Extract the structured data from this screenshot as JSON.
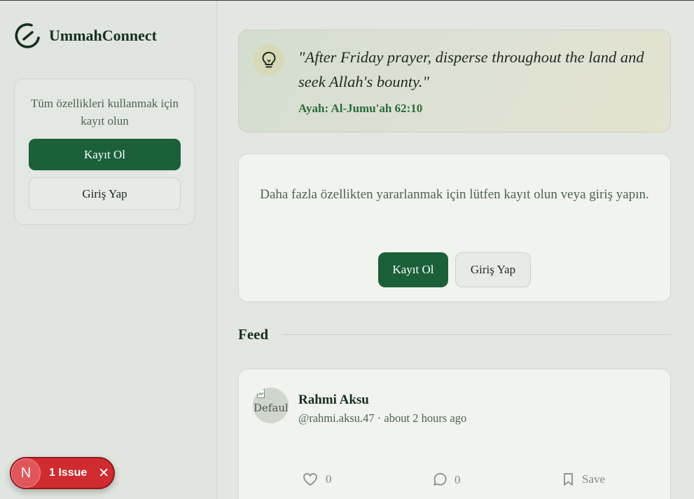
{
  "brand": {
    "name": "UmmahConnect",
    "logo_icon": "crescent-logo-icon"
  },
  "sidebar": {
    "auth_message": "Tüm özellikleri kullanmak için kayıt olun",
    "register_label": "Kayıt Ol",
    "login_label": "Giriş Yap"
  },
  "verse": {
    "icon": "lightbulb-icon",
    "text": "\"After Friday prayer, disperse throughout the land and seek Allah's bounty.\"",
    "reference": "Ayah: Al-Jumu'ah 62:10"
  },
  "prompt": {
    "message": "Daha fazla özellikten yararlanmak için lütfen kayıt olun veya giriş yapın.",
    "register_label": "Kayıt Ol",
    "login_label": "Giriş Yap"
  },
  "feed": {
    "title": "Feed",
    "posts": [
      {
        "avatar_alt": "Default",
        "name": "Rahmi Aksu",
        "meta": "@rahmi.aksu.47 · about 2 hours ago",
        "likes": "0",
        "comments": "0",
        "save_label": "Save"
      }
    ]
  },
  "issue_badge": {
    "avatar_letter": "N",
    "label": "1 Issue",
    "close": "✕"
  },
  "colors": {
    "primary": "#1b6039",
    "background": "#e4e7e1",
    "card": "#f0f3ee",
    "issue": "#d02b2f"
  }
}
